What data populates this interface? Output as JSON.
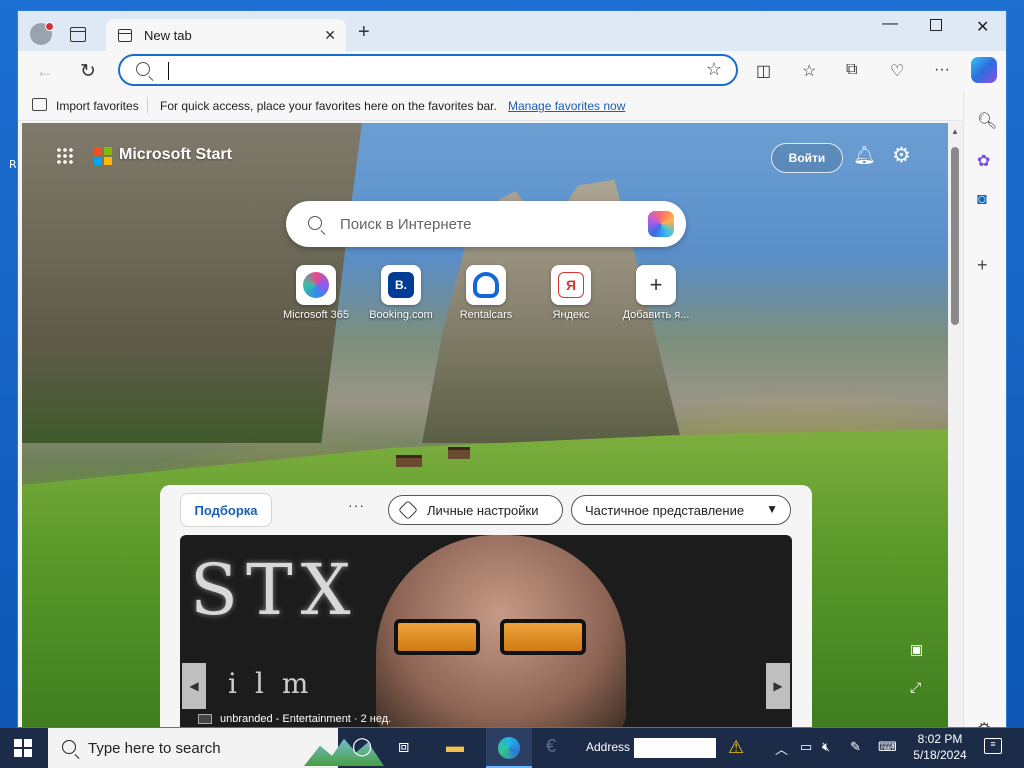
{
  "window": {
    "tab_title": "New tab",
    "new_tab_symbol": "+",
    "controls": {
      "minimize": "—",
      "close": "✕"
    }
  },
  "toolbar": {
    "address_value": "",
    "icons": [
      "split-screen-icon",
      "favorites-icon",
      "collections-icon",
      "browser-essentials-icon",
      "more-icon",
      "copilot-icon"
    ]
  },
  "favorites_bar": {
    "import_label": "Import favorites",
    "hint_text": "For quick access, place your favorites here on the favorites bar.",
    "manage_link": "Manage favorites now"
  },
  "newtab": {
    "brand": "Microsoft Start",
    "signin_label": "Войти",
    "search_placeholder": "Поиск в Интернете",
    "quick_links": [
      {
        "label": "Microsoft 365",
        "icon": "microsoft365-icon"
      },
      {
        "label": "Booking.com",
        "icon_text": "B."
      },
      {
        "label": "Rentalcars",
        "icon": "rentalcars-icon"
      },
      {
        "label": "Яндекс",
        "icon_text": "Я"
      },
      {
        "label": "Добавить я...",
        "icon_text": "+"
      }
    ]
  },
  "feed": {
    "tab_label": "Подборка",
    "more_label": "···",
    "personalize_label": "Личные настройки",
    "view_label": "Частичное представление",
    "hero": {
      "title_letters": "STX",
      "sub_letters": "ilm",
      "caption": "unbranded - Entertainment · 2 нед."
    }
  },
  "taskbar": {
    "search_placeholder": "Type here to search",
    "address_label": "Address",
    "time": "8:02 PM",
    "date": "5/18/2024"
  },
  "desktop": {
    "stray_char": "R"
  },
  "colors": {
    "accent": "#1a6dcf",
    "link": "#1a5fb4",
    "taskbar": "#1b2b48",
    "titlebar": "#dfe9f6"
  }
}
